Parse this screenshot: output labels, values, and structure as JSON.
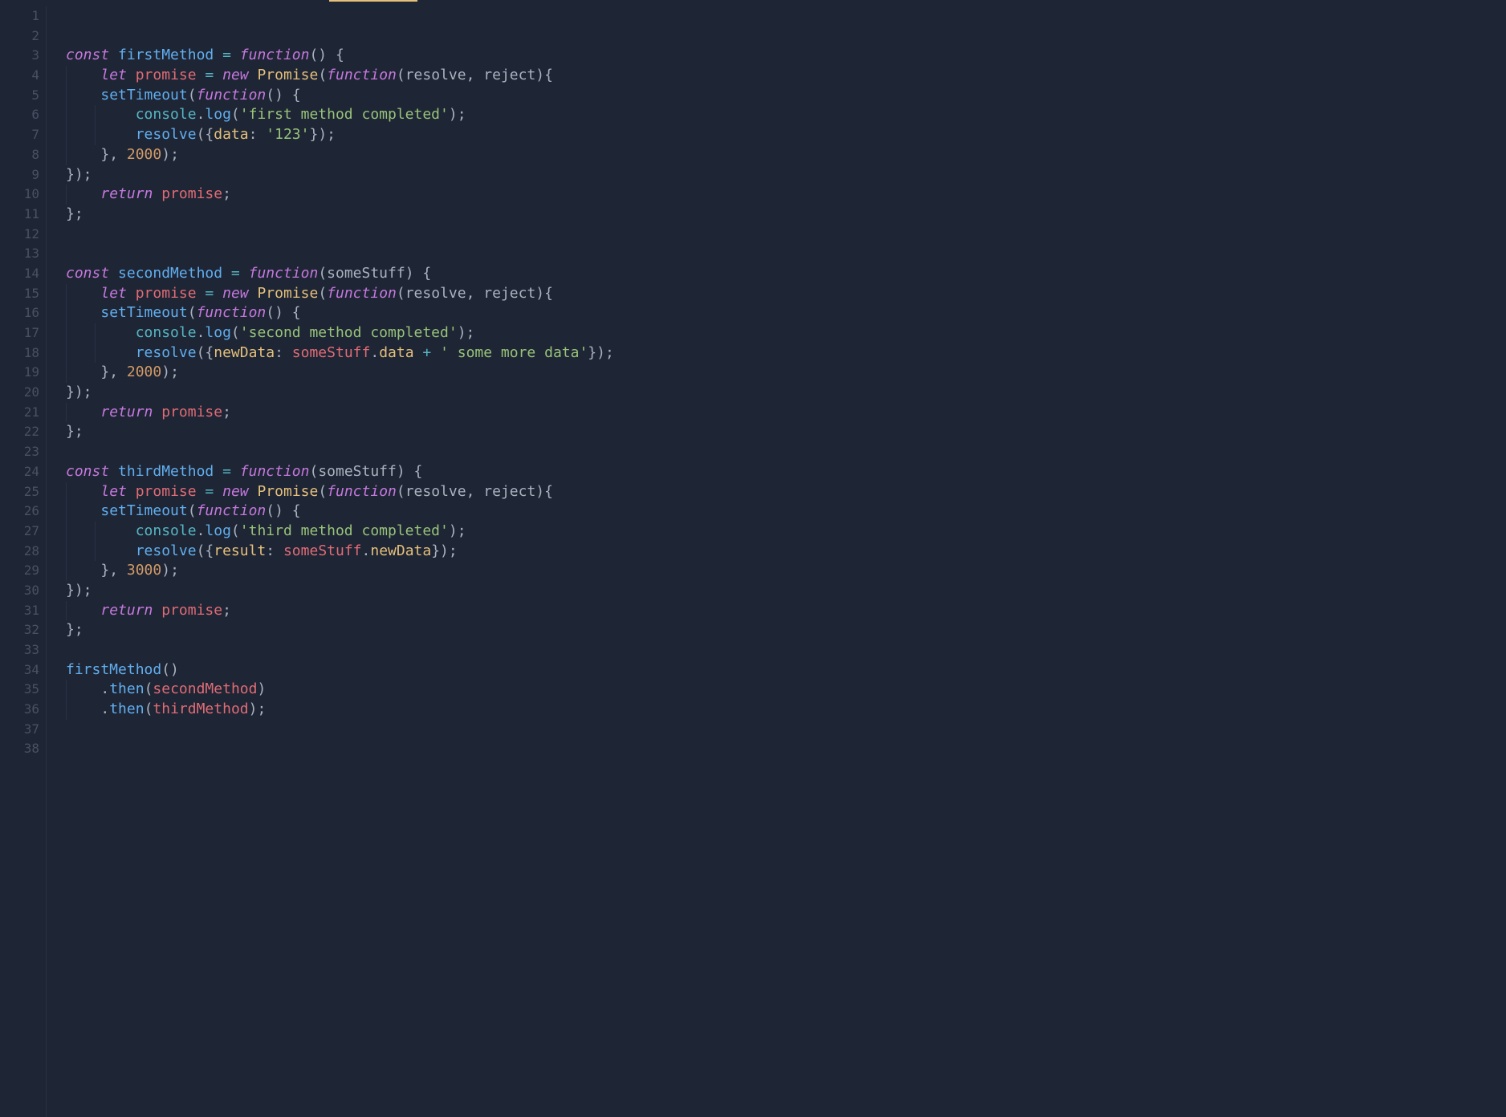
{
  "theme": {
    "background": "#1e2535",
    "gutter_fg": "#495162",
    "text": "#abb2bf",
    "keyword": "#c678dd",
    "variable": "#e06c75",
    "function": "#61afef",
    "class": "#e5c07b",
    "object": "#56b6c2",
    "string": "#98c379",
    "number": "#d19a66",
    "property": "#e5c07b",
    "operator": "#56b6c2",
    "tab_indicator": "#e5c07b"
  },
  "line_numbers": [
    "1",
    "2",
    "3",
    "4",
    "5",
    "6",
    "7",
    "8",
    "9",
    "10",
    "11",
    "12",
    "13",
    "14",
    "15",
    "16",
    "17",
    "18",
    "19",
    "20",
    "21",
    "22",
    "23",
    "24",
    "25",
    "26",
    "27",
    "28",
    "29",
    "30",
    "31",
    "32",
    "33",
    "34",
    "35",
    "36",
    "37",
    "38"
  ],
  "code": {
    "lines": [
      {
        "n": 1,
        "indent": 0,
        "tokens": []
      },
      {
        "n": 2,
        "indent": 0,
        "tokens": []
      },
      {
        "n": 3,
        "indent": 0,
        "tokens": [
          {
            "t": "const ",
            "c": "kw"
          },
          {
            "t": "firstMethod ",
            "c": "fn"
          },
          {
            "t": "= ",
            "c": "op"
          },
          {
            "t": "function",
            "c": "kw"
          },
          {
            "t": "() {",
            "c": "pun"
          }
        ]
      },
      {
        "n": 4,
        "indent": 1,
        "tokens": [
          {
            "t": "let ",
            "c": "kw"
          },
          {
            "t": "promise ",
            "c": "var"
          },
          {
            "t": "= ",
            "c": "op"
          },
          {
            "t": "new ",
            "c": "kw"
          },
          {
            "t": "Promise",
            "c": "cls"
          },
          {
            "t": "(",
            "c": "pun"
          },
          {
            "t": "function",
            "c": "kw"
          },
          {
            "t": "(",
            "c": "pun"
          },
          {
            "t": "resolve",
            "c": "param"
          },
          {
            "t": ", ",
            "c": "pun"
          },
          {
            "t": "reject",
            "c": "param"
          },
          {
            "t": "){",
            "c": "pun"
          }
        ]
      },
      {
        "n": 5,
        "indent": 1,
        "tokens": [
          {
            "t": "setTimeout",
            "c": "fn"
          },
          {
            "t": "(",
            "c": "pun"
          },
          {
            "t": "function",
            "c": "kw"
          },
          {
            "t": "() {",
            "c": "pun"
          }
        ]
      },
      {
        "n": 6,
        "indent": 2,
        "tokens": [
          {
            "t": "console",
            "c": "obj"
          },
          {
            "t": ".",
            "c": "pun"
          },
          {
            "t": "log",
            "c": "fn"
          },
          {
            "t": "(",
            "c": "pun"
          },
          {
            "t": "'first method completed'",
            "c": "str"
          },
          {
            "t": ");",
            "c": "pun"
          }
        ]
      },
      {
        "n": 7,
        "indent": 2,
        "tokens": [
          {
            "t": "resolve",
            "c": "fn"
          },
          {
            "t": "({",
            "c": "pun"
          },
          {
            "t": "data",
            "c": "prop"
          },
          {
            "t": ": ",
            "c": "pun"
          },
          {
            "t": "'123'",
            "c": "str"
          },
          {
            "t": "});",
            "c": "pun"
          }
        ]
      },
      {
        "n": 8,
        "indent": 1,
        "tokens": [
          {
            "t": "}, ",
            "c": "pun"
          },
          {
            "t": "2000",
            "c": "num"
          },
          {
            "t": ");",
            "c": "pun"
          }
        ]
      },
      {
        "n": 9,
        "indent": 0,
        "tokens": [
          {
            "t": "});",
            "c": "pun"
          }
        ]
      },
      {
        "n": 10,
        "indent": 1,
        "tokens": [
          {
            "t": "return ",
            "c": "kw"
          },
          {
            "t": "promise",
            "c": "var"
          },
          {
            "t": ";",
            "c": "pun"
          }
        ]
      },
      {
        "n": 11,
        "indent": 0,
        "tokens": [
          {
            "t": "};",
            "c": "pun"
          }
        ]
      },
      {
        "n": 12,
        "indent": 0,
        "tokens": []
      },
      {
        "n": 13,
        "indent": 0,
        "tokens": []
      },
      {
        "n": 14,
        "indent": 0,
        "tokens": [
          {
            "t": "const ",
            "c": "kw"
          },
          {
            "t": "secondMethod ",
            "c": "fn"
          },
          {
            "t": "= ",
            "c": "op"
          },
          {
            "t": "function",
            "c": "kw"
          },
          {
            "t": "(",
            "c": "pun"
          },
          {
            "t": "someStuff",
            "c": "param"
          },
          {
            "t": ") {",
            "c": "pun"
          }
        ]
      },
      {
        "n": 15,
        "indent": 1,
        "tokens": [
          {
            "t": "let ",
            "c": "kw"
          },
          {
            "t": "promise ",
            "c": "var"
          },
          {
            "t": "= ",
            "c": "op"
          },
          {
            "t": "new ",
            "c": "kw"
          },
          {
            "t": "Promise",
            "c": "cls"
          },
          {
            "t": "(",
            "c": "pun"
          },
          {
            "t": "function",
            "c": "kw"
          },
          {
            "t": "(",
            "c": "pun"
          },
          {
            "t": "resolve",
            "c": "param"
          },
          {
            "t": ", ",
            "c": "pun"
          },
          {
            "t": "reject",
            "c": "param"
          },
          {
            "t": "){",
            "c": "pun"
          }
        ]
      },
      {
        "n": 16,
        "indent": 1,
        "tokens": [
          {
            "t": "setTimeout",
            "c": "fn"
          },
          {
            "t": "(",
            "c": "pun"
          },
          {
            "t": "function",
            "c": "kw"
          },
          {
            "t": "() {",
            "c": "pun"
          }
        ]
      },
      {
        "n": 17,
        "indent": 2,
        "tokens": [
          {
            "t": "console",
            "c": "obj"
          },
          {
            "t": ".",
            "c": "pun"
          },
          {
            "t": "log",
            "c": "fn"
          },
          {
            "t": "(",
            "c": "pun"
          },
          {
            "t": "'second method completed'",
            "c": "str"
          },
          {
            "t": ");",
            "c": "pun"
          }
        ]
      },
      {
        "n": 18,
        "indent": 2,
        "tokens": [
          {
            "t": "resolve",
            "c": "fn"
          },
          {
            "t": "({",
            "c": "pun"
          },
          {
            "t": "newData",
            "c": "prop"
          },
          {
            "t": ": ",
            "c": "pun"
          },
          {
            "t": "someStuff",
            "c": "var"
          },
          {
            "t": ".",
            "c": "pun"
          },
          {
            "t": "data ",
            "c": "prop"
          },
          {
            "t": "+ ",
            "c": "op"
          },
          {
            "t": "' some more data'",
            "c": "str"
          },
          {
            "t": "});",
            "c": "pun"
          }
        ]
      },
      {
        "n": 19,
        "indent": 1,
        "tokens": [
          {
            "t": "}, ",
            "c": "pun"
          },
          {
            "t": "2000",
            "c": "num"
          },
          {
            "t": ");",
            "c": "pun"
          }
        ]
      },
      {
        "n": 20,
        "indent": 0,
        "tokens": [
          {
            "t": "});",
            "c": "pun"
          }
        ]
      },
      {
        "n": 21,
        "indent": 1,
        "tokens": [
          {
            "t": "return ",
            "c": "kw"
          },
          {
            "t": "promise",
            "c": "var"
          },
          {
            "t": ";",
            "c": "pun"
          }
        ]
      },
      {
        "n": 22,
        "indent": 0,
        "tokens": [
          {
            "t": "};",
            "c": "pun"
          }
        ]
      },
      {
        "n": 23,
        "indent": 0,
        "tokens": []
      },
      {
        "n": 24,
        "indent": 0,
        "tokens": [
          {
            "t": "const ",
            "c": "kw"
          },
          {
            "t": "thirdMethod ",
            "c": "fn"
          },
          {
            "t": "= ",
            "c": "op"
          },
          {
            "t": "function",
            "c": "kw"
          },
          {
            "t": "(",
            "c": "pun"
          },
          {
            "t": "someStuff",
            "c": "param"
          },
          {
            "t": ") {",
            "c": "pun"
          }
        ]
      },
      {
        "n": 25,
        "indent": 1,
        "tokens": [
          {
            "t": "let ",
            "c": "kw"
          },
          {
            "t": "promise ",
            "c": "var"
          },
          {
            "t": "= ",
            "c": "op"
          },
          {
            "t": "new ",
            "c": "kw"
          },
          {
            "t": "Promise",
            "c": "cls"
          },
          {
            "t": "(",
            "c": "pun"
          },
          {
            "t": "function",
            "c": "kw"
          },
          {
            "t": "(",
            "c": "pun"
          },
          {
            "t": "resolve",
            "c": "param"
          },
          {
            "t": ", ",
            "c": "pun"
          },
          {
            "t": "reject",
            "c": "param"
          },
          {
            "t": "){",
            "c": "pun"
          }
        ]
      },
      {
        "n": 26,
        "indent": 1,
        "tokens": [
          {
            "t": "setTimeout",
            "c": "fn"
          },
          {
            "t": "(",
            "c": "pun"
          },
          {
            "t": "function",
            "c": "kw"
          },
          {
            "t": "() {",
            "c": "pun"
          }
        ]
      },
      {
        "n": 27,
        "indent": 2,
        "tokens": [
          {
            "t": "console",
            "c": "obj"
          },
          {
            "t": ".",
            "c": "pun"
          },
          {
            "t": "log",
            "c": "fn"
          },
          {
            "t": "(",
            "c": "pun"
          },
          {
            "t": "'third method completed'",
            "c": "str"
          },
          {
            "t": ");",
            "c": "pun"
          }
        ]
      },
      {
        "n": 28,
        "indent": 2,
        "tokens": [
          {
            "t": "resolve",
            "c": "fn"
          },
          {
            "t": "({",
            "c": "pun"
          },
          {
            "t": "result",
            "c": "prop"
          },
          {
            "t": ": ",
            "c": "pun"
          },
          {
            "t": "someStuff",
            "c": "var"
          },
          {
            "t": ".",
            "c": "pun"
          },
          {
            "t": "newData",
            "c": "prop"
          },
          {
            "t": "});",
            "c": "pun"
          }
        ]
      },
      {
        "n": 29,
        "indent": 1,
        "tokens": [
          {
            "t": "}, ",
            "c": "pun"
          },
          {
            "t": "3000",
            "c": "num"
          },
          {
            "t": ");",
            "c": "pun"
          }
        ]
      },
      {
        "n": 30,
        "indent": 0,
        "tokens": [
          {
            "t": "});",
            "c": "pun"
          }
        ]
      },
      {
        "n": 31,
        "indent": 1,
        "tokens": [
          {
            "t": "return ",
            "c": "kw"
          },
          {
            "t": "promise",
            "c": "var"
          },
          {
            "t": ";",
            "c": "pun"
          }
        ]
      },
      {
        "n": 32,
        "indent": 0,
        "tokens": [
          {
            "t": "};",
            "c": "pun"
          }
        ]
      },
      {
        "n": 33,
        "indent": 0,
        "tokens": []
      },
      {
        "n": 34,
        "indent": 0,
        "tokens": [
          {
            "t": "firstMethod",
            "c": "fn"
          },
          {
            "t": "()",
            "c": "pun"
          }
        ]
      },
      {
        "n": 35,
        "indent": 1,
        "tokens": [
          {
            "t": ".",
            "c": "pun"
          },
          {
            "t": "then",
            "c": "fn"
          },
          {
            "t": "(",
            "c": "pun"
          },
          {
            "t": "secondMethod",
            "c": "var"
          },
          {
            "t": ")",
            "c": "pun"
          }
        ]
      },
      {
        "n": 36,
        "indent": 1,
        "tokens": [
          {
            "t": ".",
            "c": "pun"
          },
          {
            "t": "then",
            "c": "fn"
          },
          {
            "t": "(",
            "c": "pun"
          },
          {
            "t": "thirdMethod",
            "c": "var"
          },
          {
            "t": ");",
            "c": "pun"
          }
        ]
      },
      {
        "n": 37,
        "indent": 0,
        "tokens": []
      },
      {
        "n": 38,
        "indent": 0,
        "tokens": []
      }
    ]
  }
}
